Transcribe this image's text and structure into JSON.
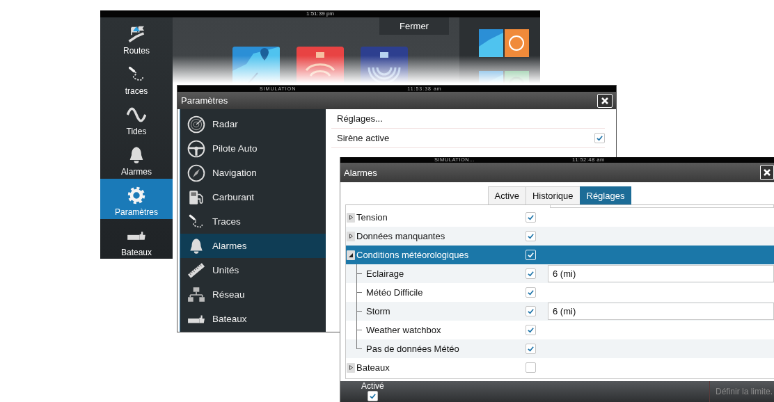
{
  "home_screen": {
    "clock": "1:51:39 pm",
    "sidebar": [
      {
        "label": "Routes",
        "kind": "routes",
        "selected": false
      },
      {
        "label": "traces",
        "kind": "trails",
        "selected": false
      },
      {
        "label": "Tides",
        "kind": "tides",
        "selected": false
      },
      {
        "label": "Alarmes",
        "kind": "alarms",
        "selected": false
      },
      {
        "label": "Paramètres",
        "kind": "settings",
        "selected": true
      },
      {
        "label": "Bateaux",
        "kind": "vessels",
        "selected": false
      }
    ],
    "close_button": "Fermer"
  },
  "settings_dialog": {
    "status": "SIMULATION",
    "clock": "11:53:38 am",
    "title": "Paramètres",
    "menu": [
      {
        "label": "Radar",
        "kind": "radar",
        "selected": false
      },
      {
        "label": "Pilote Auto",
        "kind": "autopilot",
        "selected": false
      },
      {
        "label": "Navigation",
        "kind": "navigation",
        "selected": false
      },
      {
        "label": "Carburant",
        "kind": "fuel",
        "selected": false
      },
      {
        "label": "Traces",
        "kind": "trails",
        "selected": false
      },
      {
        "label": "Alarmes",
        "kind": "alarms",
        "selected": true
      },
      {
        "label": "Unités",
        "kind": "units",
        "selected": false
      },
      {
        "label": "Réseau",
        "kind": "network",
        "selected": false
      },
      {
        "label": "Bateaux",
        "kind": "vessels",
        "selected": false
      }
    ],
    "panel": [
      {
        "kind": "action",
        "label": "Réglages..."
      },
      {
        "kind": "toggle",
        "label": "Sirène active",
        "checked": true
      }
    ]
  },
  "alarms_dialog": {
    "status": "SIMULATION...",
    "clock": "11:52:48 am",
    "title": "Alarmes",
    "tabs": [
      {
        "label": "Active",
        "selected": false
      },
      {
        "label": "Historique",
        "selected": false
      },
      {
        "label": "Réglages",
        "selected": true
      }
    ],
    "rows": [
      {
        "label": "Tension",
        "checked": true,
        "expanded": false,
        "selected": false
      },
      {
        "label": "Données manquantes",
        "checked": true,
        "expanded": false,
        "selected": false
      },
      {
        "label": "Conditions météorologiques",
        "checked": true,
        "expanded": true,
        "selected": true,
        "children": [
          {
            "label": "Eclairage",
            "checked": true,
            "selected": false,
            "value": "6 (mi)"
          },
          {
            "label": "Météo Difficile",
            "checked": true,
            "selected": false
          },
          {
            "label": "Storm",
            "checked": true,
            "selected": false,
            "value": "6 (mi)"
          },
          {
            "label": "Weather watchbox",
            "checked": true,
            "selected": false
          },
          {
            "label": "Pas de données Météo",
            "checked": true,
            "selected": false
          }
        ]
      },
      {
        "label": "Bateaux",
        "checked": false,
        "expanded": false,
        "selected": false
      }
    ],
    "footer": {
      "enabled_label": "Activé",
      "enabled": true,
      "limit_button": {
        "label": "Définir la limite.",
        "disabled": true
      }
    }
  }
}
